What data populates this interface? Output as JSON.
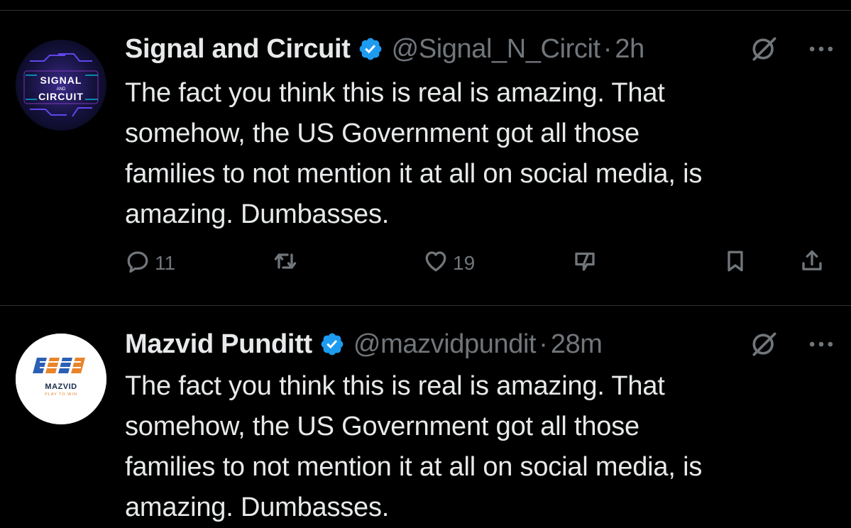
{
  "tweets": [
    {
      "avatar_text": [
        "SIGNAL",
        "AND",
        "CIRCUIT"
      ],
      "name": "Signal and Circuit",
      "handle": "@Signal_N_Circit",
      "separator": "·",
      "time": "2h",
      "lines": [
        "The fact you think this is real is amazing. That",
        "somehow, the US Government got all those",
        "families to not mention it at all on social media, is",
        "amazing. Dumbasses."
      ],
      "actions": {
        "replies": "11",
        "likes": "19"
      }
    },
    {
      "avatar_text": [
        "MAZVID",
        "PLAY TO WIN"
      ],
      "name": "Mazvid Punditt",
      "handle": "@mazvidpundit",
      "separator": "·",
      "time": "28m",
      "lines": [
        "The fact you think this is real is amazing. That",
        "somehow, the US Government got all those",
        "families to not mention it at all on social media, is",
        "amazing. Dumbasses."
      ]
    }
  ],
  "colors": {
    "background": "#000000",
    "text": "#e7e9ea",
    "muted": "#71767b",
    "verified": "#1d9bf0",
    "divider": "#2f3336"
  },
  "icons": [
    "verified-badge-icon",
    "grok-icon",
    "more-icon",
    "reply-icon",
    "retweet-icon",
    "like-icon",
    "grok-image-icon",
    "bookmark-icon",
    "share-icon"
  ]
}
